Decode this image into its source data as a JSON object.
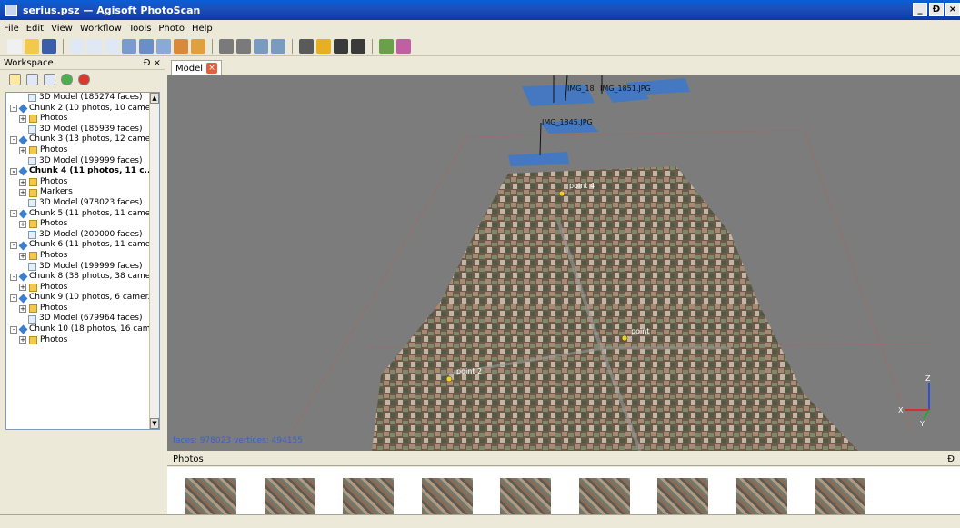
{
  "window": {
    "title": "serius.psz — Agisoft PhotoScan",
    "buttons": [
      "_",
      "Ɖ",
      "×"
    ]
  },
  "menu": [
    "File",
    "Edit",
    "View",
    "Workflow",
    "Tools",
    "Photo",
    "Help"
  ],
  "toolbar_icons": [
    "new-icon",
    "open-icon",
    "save-icon",
    "select-icon",
    "rect-select-icon",
    "circle-select-icon",
    "move-icon",
    "rotate-icon",
    "zoom-icon",
    "region-icon",
    "ruler-icon",
    "delete-icon",
    "crop-icon",
    "undo-icon",
    "redo-icon",
    "points-icon",
    "solid-icon",
    "textured-icon",
    "wireframe-icon",
    "camera-icon",
    "markers-icon"
  ],
  "workspace": {
    "title": "Workspace",
    "pin": "Ɖ ×",
    "tree": [
      {
        "label": "3D Model (185274 faces)",
        "kind": "model",
        "indent": 2,
        "exp": ""
      },
      {
        "label": "Chunk 2 (10 photos, 10 came...",
        "kind": "chunk",
        "indent": 0,
        "exp": "-"
      },
      {
        "label": "Photos",
        "kind": "folder",
        "indent": 1,
        "exp": "+"
      },
      {
        "label": "3D Model (185939 faces)",
        "kind": "model",
        "indent": 2,
        "exp": ""
      },
      {
        "label": "Chunk 3 (13 photos, 12 came...",
        "kind": "chunk",
        "indent": 0,
        "exp": "-"
      },
      {
        "label": "Photos",
        "kind": "folder",
        "indent": 1,
        "exp": "+"
      },
      {
        "label": "3D Model (199999 faces)",
        "kind": "model",
        "indent": 2,
        "exp": ""
      },
      {
        "label": "Chunk 4 (11 photos, 11 c...",
        "kind": "chunk",
        "indent": 0,
        "exp": "-",
        "bold": true
      },
      {
        "label": "Photos",
        "kind": "folder",
        "indent": 1,
        "exp": "+"
      },
      {
        "label": "Markers",
        "kind": "folder",
        "indent": 1,
        "exp": "+"
      },
      {
        "label": "3D Model (978023 faces)",
        "kind": "model",
        "indent": 2,
        "exp": ""
      },
      {
        "label": "Chunk 5 (11 photos, 11 came...",
        "kind": "chunk",
        "indent": 0,
        "exp": "-"
      },
      {
        "label": "Photos",
        "kind": "folder",
        "indent": 1,
        "exp": "+"
      },
      {
        "label": "3D Model (200000 faces)",
        "kind": "model",
        "indent": 2,
        "exp": ""
      },
      {
        "label": "Chunk 6 (11 photos, 11 came...",
        "kind": "chunk",
        "indent": 0,
        "exp": "-"
      },
      {
        "label": "Photos",
        "kind": "folder",
        "indent": 1,
        "exp": "+"
      },
      {
        "label": "3D Model (199999 faces)",
        "kind": "model",
        "indent": 2,
        "exp": ""
      },
      {
        "label": "Chunk 8 (38 photos, 38 came...",
        "kind": "chunk",
        "indent": 0,
        "exp": "-"
      },
      {
        "label": "Photos",
        "kind": "folder",
        "indent": 1,
        "exp": "+"
      },
      {
        "label": "Chunk 9 (10 photos, 6 camer...",
        "kind": "chunk",
        "indent": 0,
        "exp": "-"
      },
      {
        "label": "Photos",
        "kind": "folder",
        "indent": 1,
        "exp": "+"
      },
      {
        "label": "3D Model (679964 faces)",
        "kind": "model",
        "indent": 2,
        "exp": ""
      },
      {
        "label": "Chunk 10 (18 photos, 16 cam...",
        "kind": "chunk",
        "indent": 0,
        "exp": "-"
      },
      {
        "label": "Photos",
        "kind": "folder",
        "indent": 1,
        "exp": "+"
      }
    ]
  },
  "model_tab": {
    "label": "Model",
    "close": "×"
  },
  "viewport": {
    "stats": "faces: 978023 vertices: 494155",
    "camera_labels": [
      "IMG_1845.JPG",
      "IMG_18",
      "IMG_1851.JPG"
    ],
    "markers": [
      "point 4",
      "point",
      "point 2"
    ],
    "axes": [
      "Z",
      "X",
      "Y"
    ]
  },
  "photos_panel": {
    "title": "Photos",
    "pin": "Ɖ",
    "thumb_count": 9
  }
}
